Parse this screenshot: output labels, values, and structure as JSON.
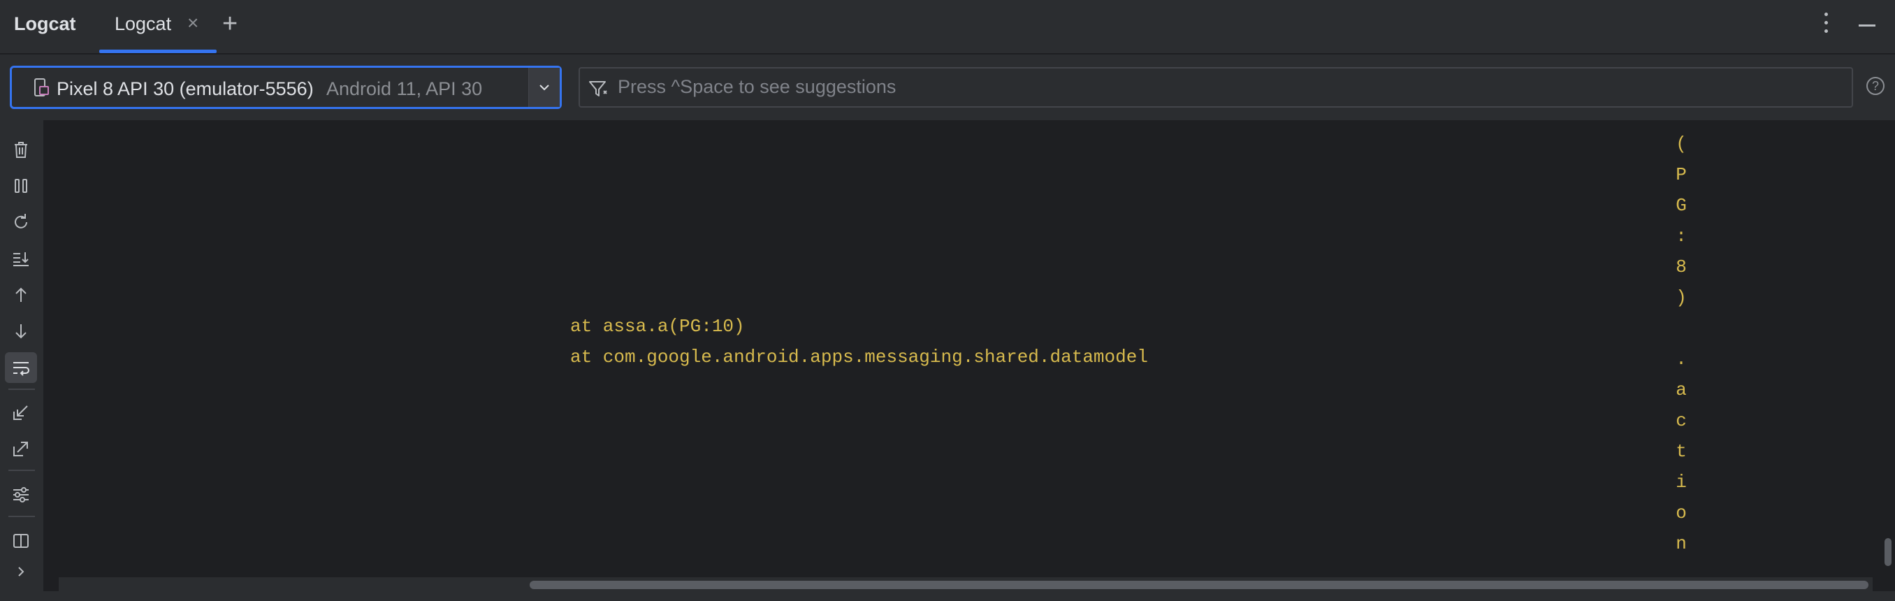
{
  "header": {
    "app_title": "Logcat",
    "tabs": [
      {
        "label": "Logcat",
        "close": "×"
      }
    ],
    "add_tab": "+"
  },
  "toolbar": {
    "device": {
      "name": "Pixel 8 API 30 (emulator-5556)",
      "api": "Android 11, API 30"
    },
    "filter": {
      "placeholder": "Press ^Space to see suggestions"
    },
    "help": "?"
  },
  "sidebar": {
    "tools": [
      {
        "name": "clear-logcat",
        "icon": "trash-icon"
      },
      {
        "name": "pause",
        "icon": "pause-icon"
      },
      {
        "name": "restart",
        "icon": "restart-icon"
      },
      {
        "name": "scroll-to-end",
        "icon": "scroll-to-end-icon"
      },
      {
        "name": "previous-occurrence",
        "icon": "arrow-up-icon"
      },
      {
        "name": "next-occurrence",
        "icon": "arrow-down-icon"
      },
      {
        "name": "soft-wrap",
        "icon": "soft-wrap-icon",
        "active": true
      },
      {
        "name": "import",
        "icon": "import-icon"
      },
      {
        "name": "export",
        "icon": "export-icon"
      },
      {
        "name": "format-settings",
        "icon": "settings-sliders-icon"
      },
      {
        "name": "split-panels",
        "icon": "split-panel-icon"
      },
      {
        "name": "more",
        "icon": "chevron-right-icon"
      }
    ]
  },
  "log": {
    "lines": [
      "at assa.a(PG:10)",
      "at com.google.android.apps.messaging.shared.datamodel"
    ],
    "wrapped_chars": [
      "(",
      "P",
      "G",
      ":",
      "8",
      ")",
      "",
      ".",
      "a",
      "c",
      "t",
      "i",
      "o",
      "n"
    ]
  },
  "colors": {
    "accent": "#3574f0",
    "log_text": "#d7ba4e",
    "background": "#1e1f22",
    "panel": "#2b2d30"
  }
}
